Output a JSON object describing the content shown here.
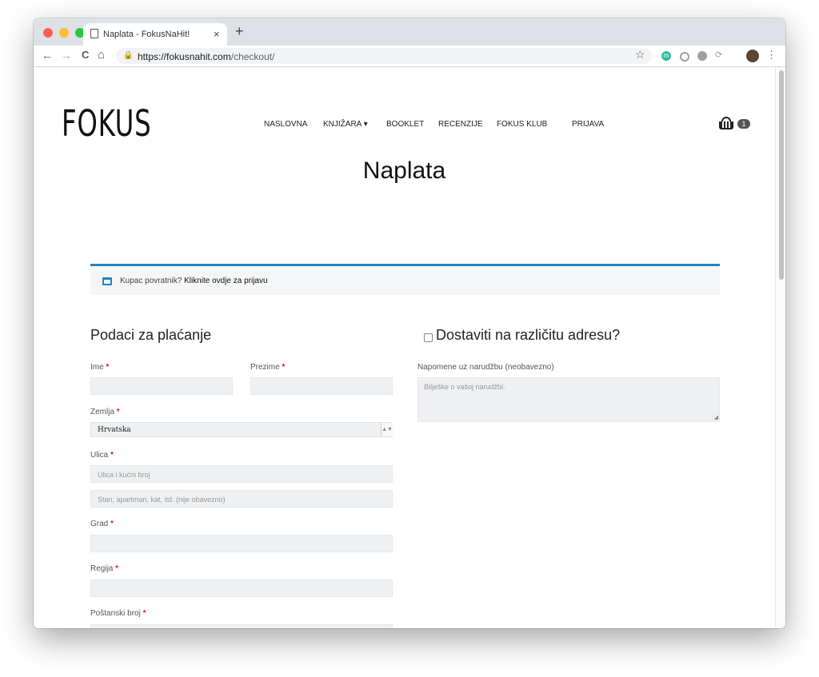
{
  "browser": {
    "tab_title": "Naplata - FokusNaHit!",
    "tab_close": "×",
    "new_tab": "+",
    "url_host": "https://fokusnahit.com",
    "url_path": "/checkout/",
    "back": "←",
    "forward": "→",
    "reload": "C",
    "home": "⌂",
    "lock": "🔒",
    "star": "☆",
    "extension_letter": "m",
    "menu": "⋮"
  },
  "site": {
    "logo": "FOKUS",
    "nav": [
      "NASLOVNA",
      "KNJIŽARA ▾",
      "BOOKLET",
      "RECENZIJE",
      "FOKUS KLUB",
      "PRIJAVA"
    ],
    "cart_count": "1"
  },
  "page": {
    "title": "Naplata",
    "notice_text": "Kupac povratnik?",
    "notice_link": "Kliknite ovdje za prijavu"
  },
  "billing": {
    "heading": "Podaci za plaćanje",
    "first_name_label": "Ime",
    "last_name_label": "Prezime",
    "country_label": "Zemlja",
    "country_value": "Hrvatska",
    "street_label": "Ulica",
    "street_placeholder": "Ulica i kućni broj",
    "street2_placeholder": "Stan, apartman, kat, itd. (nije obavezno)",
    "city_label": "Grad",
    "region_label": "Regija",
    "postcode_label": "Poštanski broj",
    "required_mark": "*"
  },
  "shipping": {
    "heading": "Dostaviti na različitu adresu?",
    "notes_label": "Napomene uz narudžbu (neobavezno)",
    "notes_placeholder": "Bilješke o vašoj narudžbi."
  }
}
